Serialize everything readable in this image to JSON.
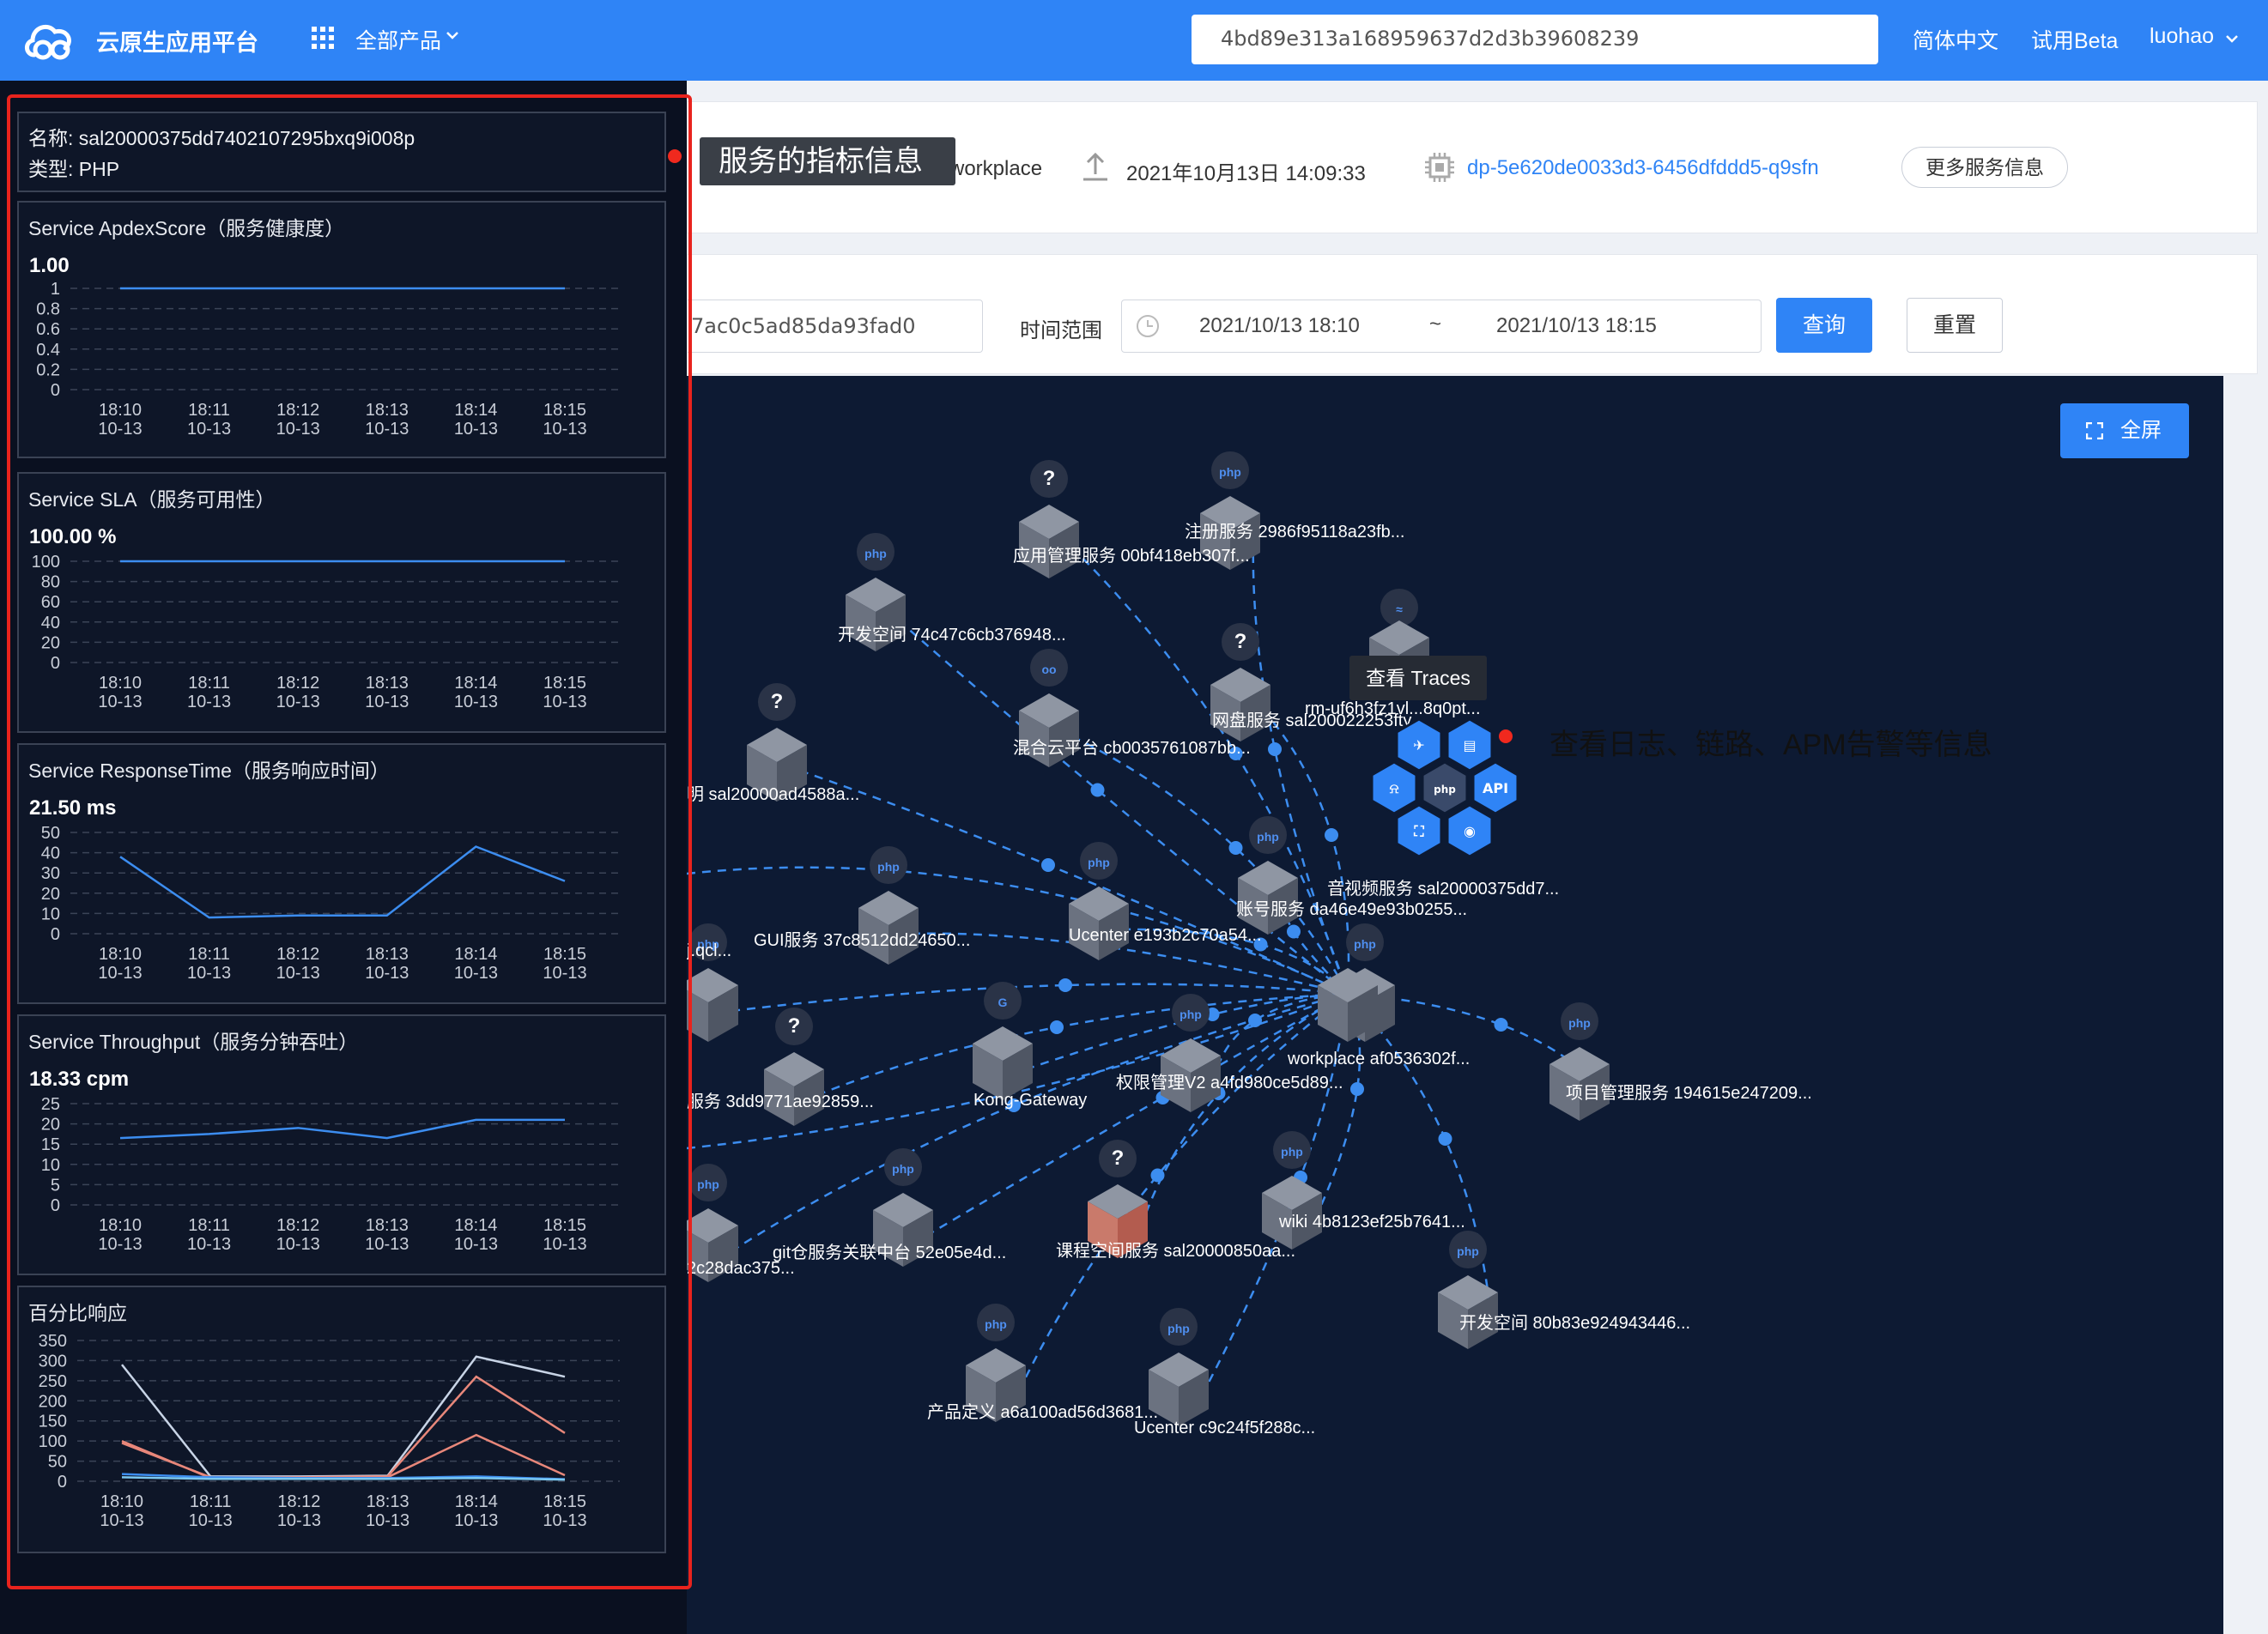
{
  "header": {
    "app_name": "云原生应用平台",
    "products_label": "全部产品",
    "search_value": "4bd89e313a168959637d2d3b39608239",
    "language": "简体中文",
    "beta": "试用Beta",
    "user": "luohao"
  },
  "service_info": {
    "workplace": "workplace",
    "deploy_time": "2021年10月13日 14:09:33",
    "pod_name": "dp-5e620de0033d3-6456dfddd5-q9sfn",
    "more_button": "更多服务信息"
  },
  "query": {
    "id_value": "7ac0c5ad85da93fad0",
    "time_range_label": "时间范围",
    "start": "2021/10/13 18:10",
    "separator": "~",
    "end": "2021/10/13 18:15",
    "query_button": "查询",
    "reset_button": "重置"
  },
  "topology": {
    "fullscreen_button": "全屏",
    "traces_tooltip": "查看 Traces",
    "nodes": [
      {
        "label": "注册服务 2986f95118a23fb...",
        "kind": "php"
      },
      {
        "label": "应用管理服务 00bf418eb307f...",
        "kind": "unknown"
      },
      {
        "label": "开发空间 74c47c6cb376948...",
        "kind": "php"
      },
      {
        "label": "网盘服务 sal200022253fty...",
        "kind": "unknown"
      },
      {
        "label": "rm-uf6h3fz1vl...8q0pt...",
        "kind": "mysql"
      },
      {
        "label": "混合云平台 cb0035761087bb...",
        "kind": "go"
      },
      {
        "label": "明 sal20000ad4588a...",
        "kind": "unknown"
      },
      {
        "label": "音视频服务 sal20000375dd7...",
        "kind": "php"
      },
      {
        "label": "账号服务 da46e49e93b0255...",
        "kind": "php"
      },
      {
        "label": "Ucenter e193b2c70a54...",
        "kind": "php"
      },
      {
        "label": "GUI服务 37c8512dd24650...",
        "kind": "php"
      },
      {
        "label": "j.qcl...",
        "kind": "php"
      },
      {
        "label": "workplace af0536302f...",
        "kind": "php"
      },
      {
        "label": "项目管理服务 194615e247209...",
        "kind": "php"
      },
      {
        "label": "权限管理V2 a4fd980ce5d89...",
        "kind": "php"
      },
      {
        "label": "Kong-Gateway",
        "kind": "gateway"
      },
      {
        "label": "服务 3dd9771ae92859...",
        "kind": "unknown"
      },
      {
        "label": "wiki 4b8123ef25b7641...",
        "kind": "php"
      },
      {
        "label": "课程空间服务 sal20000850aa...",
        "kind": "unknown"
      },
      {
        "label": "git仓服务关联中台 52e05e4d...",
        "kind": "php"
      },
      {
        "label": "2c28dac375...",
        "kind": "php"
      },
      {
        "label": "开发空间 80b83e924943446...",
        "kind": "php"
      },
      {
        "label": "产品定义 a6a100ad56d3681...",
        "kind": "php"
      },
      {
        "label": "Ucenter c9c24f5f288c...",
        "kind": "php"
      }
    ],
    "selected_menu": [
      "trace",
      "log",
      "alarm",
      "php",
      "API",
      "topology",
      "view"
    ]
  },
  "annotations": {
    "metrics_note": "服务的指标信息",
    "apm_note": "查看日志、链路、APM告警等信息"
  },
  "panel": {
    "name_line": "名称: sal20000375dd7402107295bxq9i008p",
    "type_line": "类型: PHP"
  },
  "colors": {
    "primary": "#2f84f6",
    "series_blue": "#3c8df0",
    "series_white": "#c8d4e6",
    "series_salmon": "#e8877a",
    "alert_red": "#f0291e"
  },
  "chart_data": [
    {
      "type": "line",
      "title": "Service ApdexScore（服务健康度）",
      "current_value": "1.00",
      "categories": [
        "18:10 10-13",
        "18:11 10-13",
        "18:12 10-13",
        "18:13 10-13",
        "18:14 10-13",
        "18:15 10-13"
      ],
      "x_ticks": [
        [
          "18:10",
          "10-13"
        ],
        [
          "18:11",
          "10-13"
        ],
        [
          "18:12",
          "10-13"
        ],
        [
          "18:13",
          "10-13"
        ],
        [
          "18:14",
          "10-13"
        ],
        [
          "18:15",
          "10-13"
        ]
      ],
      "y_ticks": [
        "0",
        "0.2",
        "0.4",
        "0.6",
        "0.8",
        "1"
      ],
      "ylim": [
        0,
        1
      ],
      "series": [
        {
          "values": [
            1,
            1,
            1,
            1,
            1,
            1
          ]
        }
      ]
    },
    {
      "type": "line",
      "title": "Service SLA（服务可用性）",
      "current_value": "100.00 %",
      "categories": [
        "18:10 10-13",
        "18:11 10-13",
        "18:12 10-13",
        "18:13 10-13",
        "18:14 10-13",
        "18:15 10-13"
      ],
      "x_ticks": [
        [
          "18:10",
          "10-13"
        ],
        [
          "18:11",
          "10-13"
        ],
        [
          "18:12",
          "10-13"
        ],
        [
          "18:13",
          "10-13"
        ],
        [
          "18:14",
          "10-13"
        ],
        [
          "18:15",
          "10-13"
        ]
      ],
      "y_ticks": [
        "0",
        "20",
        "40",
        "60",
        "80",
        "100"
      ],
      "ylim": [
        0,
        100
      ],
      "series": [
        {
          "values": [
            100,
            100,
            100,
            100,
            100,
            100
          ]
        }
      ]
    },
    {
      "type": "line",
      "title": "Service ResponseTime（服务响应时间）",
      "current_value": "21.50 ms",
      "categories": [
        "18:10 10-13",
        "18:11 10-13",
        "18:12 10-13",
        "18:13 10-13",
        "18:14 10-13",
        "18:15 10-13"
      ],
      "x_ticks": [
        [
          "18:10",
          "10-13"
        ],
        [
          "18:11",
          "10-13"
        ],
        [
          "18:12",
          "10-13"
        ],
        [
          "18:13",
          "10-13"
        ],
        [
          "18:14",
          "10-13"
        ],
        [
          "18:15",
          "10-13"
        ]
      ],
      "y_ticks": [
        "0",
        "10",
        "20",
        "30",
        "40",
        "50"
      ],
      "ylim": [
        0,
        50
      ],
      "series": [
        {
          "values": [
            38,
            8,
            9,
            9,
            43,
            26
          ]
        }
      ]
    },
    {
      "type": "line",
      "title": "Service Throughput（服务分钟吞吐）",
      "current_value": "18.33 cpm",
      "categories": [
        "18:10 10-13",
        "18:11 10-13",
        "18:12 10-13",
        "18:13 10-13",
        "18:14 10-13",
        "18:15 10-13"
      ],
      "x_ticks": [
        [
          "18:10",
          "10-13"
        ],
        [
          "18:11",
          "10-13"
        ],
        [
          "18:12",
          "10-13"
        ],
        [
          "18:13",
          "10-13"
        ],
        [
          "18:14",
          "10-13"
        ],
        [
          "18:15",
          "10-13"
        ]
      ],
      "y_ticks": [
        "0",
        "5",
        "10",
        "15",
        "20",
        "25"
      ],
      "ylim": [
        0,
        25
      ],
      "series": [
        {
          "values": [
            16.5,
            17.5,
            19,
            16.5,
            21,
            21
          ]
        }
      ]
    },
    {
      "type": "line",
      "title": "百分比响应",
      "categories": [
        "18:10 10-13",
        "18:11 10-13",
        "18:12 10-13",
        "18:13 10-13",
        "18:14 10-13",
        "18:15 10-13"
      ],
      "x_ticks": [
        [
          "18:10",
          "10-13"
        ],
        [
          "18:11",
          "10-13"
        ],
        [
          "18:12",
          "10-13"
        ],
        [
          "18:13",
          "10-13"
        ],
        [
          "18:14",
          "10-13"
        ],
        [
          "18:15",
          "10-13"
        ]
      ],
      "y_ticks": [
        "0",
        "50",
        "100",
        "150",
        "200",
        "250",
        "300",
        "350"
      ],
      "ylim": [
        0,
        350
      ],
      "series": [
        {
          "values": [
            290,
            12,
            12,
            14,
            310,
            260
          ]
        },
        {
          "values": [
            95,
            10,
            10,
            12,
            260,
            120
          ]
        },
        {
          "values": [
            100,
            8,
            9,
            10,
            115,
            15
          ]
        },
        {
          "values": [
            18,
            10,
            8,
            8,
            12,
            5
          ]
        },
        {
          "values": [
            10,
            6,
            6,
            6,
            8,
            4
          ]
        }
      ]
    }
  ]
}
